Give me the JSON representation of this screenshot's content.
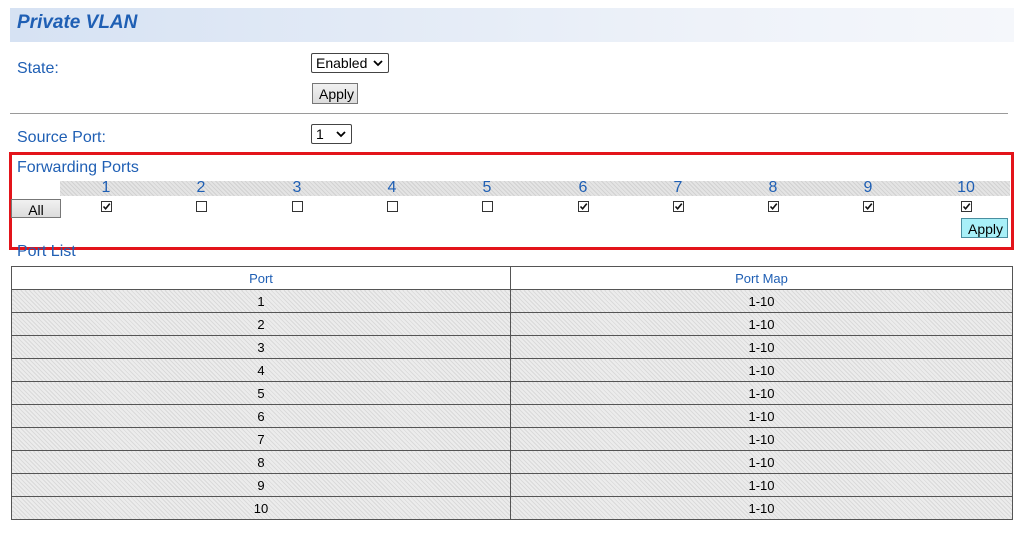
{
  "page": {
    "title": "Private VLAN"
  },
  "state": {
    "label": "State:",
    "value": "Enabled",
    "apply_label": "Apply"
  },
  "source": {
    "label": "Source Port:",
    "value": "1"
  },
  "forwarding": {
    "label": "Forwarding Ports",
    "all_label": "All",
    "apply_label": "Apply",
    "ports": [
      {
        "num": "1",
        "checked": true
      },
      {
        "num": "2",
        "checked": false
      },
      {
        "num": "3",
        "checked": false
      },
      {
        "num": "4",
        "checked": false
      },
      {
        "num": "5",
        "checked": false
      },
      {
        "num": "6",
        "checked": true
      },
      {
        "num": "7",
        "checked": true
      },
      {
        "num": "8",
        "checked": true
      },
      {
        "num": "9",
        "checked": true
      },
      {
        "num": "10",
        "checked": true
      }
    ]
  },
  "port_list": {
    "label": "Port List",
    "headers": [
      "Port",
      "Port Map"
    ],
    "rows": [
      [
        "1",
        "1-10"
      ],
      [
        "2",
        "1-10"
      ],
      [
        "3",
        "1-10"
      ],
      [
        "4",
        "1-10"
      ],
      [
        "5",
        "1-10"
      ],
      [
        "6",
        "1-10"
      ],
      [
        "7",
        "1-10"
      ],
      [
        "8",
        "1-10"
      ],
      [
        "9",
        "1-10"
      ],
      [
        "10",
        "1-10"
      ]
    ]
  },
  "colors": {
    "accent": "#1f5fb4",
    "highlight_border": "#e3141a",
    "apply_blue": "#a8f0f8"
  }
}
